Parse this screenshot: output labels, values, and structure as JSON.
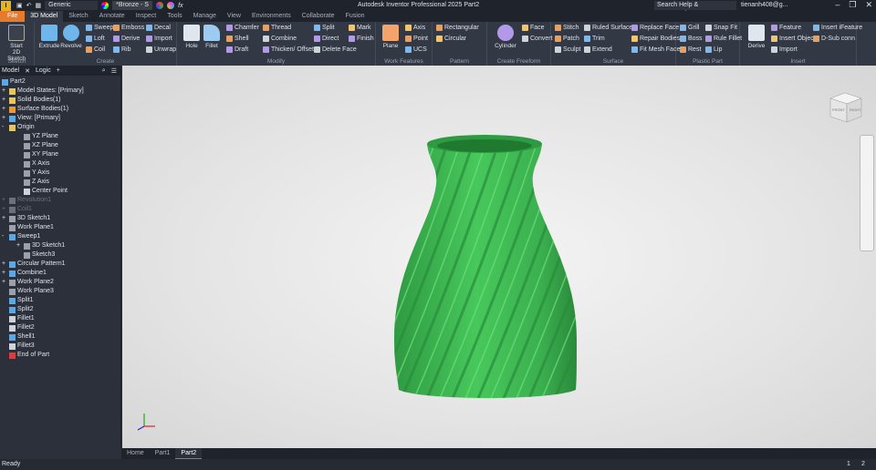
{
  "app": {
    "title": "Autodesk Inventor Professional 2025   Part2",
    "logo": "I",
    "search_placeholder": "Search Help & Commands...",
    "user": "tienanh408@g...",
    "appearance": "Generic",
    "material": "*Bronze - S"
  },
  "tabs": [
    "File",
    "3D Model",
    "Sketch",
    "Annotate",
    "Inspect",
    "Tools",
    "Manage",
    "View",
    "Environments",
    "Collaborate",
    "Fusion"
  ],
  "ribbon": {
    "sketch": {
      "label": "Sketch",
      "start": "Start",
      "start2": "2D Sketch"
    },
    "create": {
      "label": "Create",
      "extrude": "Extrude",
      "revolve": "Revolve",
      "col1": [
        "Sweep",
        "Loft",
        "Coil"
      ],
      "col2": [
        "Emboss",
        "Derive",
        "Rib"
      ],
      "col3": [
        "Decal",
        "Import",
        "Unwrap"
      ]
    },
    "modify": {
      "label": "Modify",
      "hole": "Hole",
      "fillet": "Fillet",
      "col1": [
        "Chamfer",
        "Shell",
        "Draft"
      ],
      "col2": [
        "Thread",
        "Combine",
        "Thicken/ Offset"
      ],
      "col3": [
        "Split",
        "Direct",
        "Delete Face"
      ],
      "col4": [
        "Mark",
        "Finish"
      ]
    },
    "work": {
      "label": "Work Features",
      "plane": "Plane",
      "col1": [
        "Axis",
        "Point",
        "UCS"
      ]
    },
    "pattern": {
      "label": "Pattern",
      "col1": [
        "Rectangular",
        "Circular"
      ]
    },
    "freeform": {
      "label": "Create Freeform",
      "cylinder": "Cylinder",
      "col1": [
        "Face",
        "Convert"
      ]
    },
    "surface": {
      "label": "Surface",
      "col1": [
        "Stitch",
        "Patch",
        "Sculpt"
      ],
      "col2": [
        "Ruled Surface",
        "Trim",
        "Extend"
      ],
      "col3": [
        "Replace Face",
        "Repair Bodies",
        "Fit Mesh Face"
      ]
    },
    "plastic": {
      "label": "Plastic Part",
      "col1": [
        "Grill",
        "Boss",
        "Rest"
      ],
      "col2": [
        "Snap Fit",
        "Rule Fillet",
        "Lip"
      ]
    },
    "insert": {
      "label": "Insert",
      "derive": "Derive",
      "col1": [
        "Feature",
        "Insert Object",
        "Import"
      ],
      "col2": [
        "Insert iFeature",
        "D-Sub conn"
      ]
    }
  },
  "browser": {
    "tabs": [
      "Model",
      "Logic"
    ],
    "tree": [
      {
        "label": "Part2",
        "level": 0,
        "exp": "",
        "icon": "#5aa9e6"
      },
      {
        "label": "Model States: [Primary]",
        "level": 1,
        "exp": "+",
        "icon": "#e8c65a"
      },
      {
        "label": "Solid Bodies(1)",
        "level": 1,
        "exp": "+",
        "icon": "#e8c65a"
      },
      {
        "label": "Surface Bodies(1)",
        "level": 1,
        "exp": "+",
        "icon": "#e89a3a"
      },
      {
        "label": "View: [Primary]",
        "level": 1,
        "exp": "+",
        "icon": "#5aa9e6"
      },
      {
        "label": "Origin",
        "level": 1,
        "exp": "-",
        "icon": "#e8c65a"
      },
      {
        "label": "YZ Plane",
        "level": 2,
        "exp": "",
        "icon": "#9aa1ad"
      },
      {
        "label": "XZ Plane",
        "level": 2,
        "exp": "",
        "icon": "#9aa1ad"
      },
      {
        "label": "XY Plane",
        "level": 2,
        "exp": "",
        "icon": "#9aa1ad"
      },
      {
        "label": "X Axis",
        "level": 2,
        "exp": "",
        "icon": "#9aa1ad"
      },
      {
        "label": "Y Axis",
        "level": 2,
        "exp": "",
        "icon": "#9aa1ad"
      },
      {
        "label": "Z Axis",
        "level": 2,
        "exp": "",
        "icon": "#9aa1ad"
      },
      {
        "label": "Center Point",
        "level": 2,
        "exp": "",
        "icon": "#cfd3da"
      },
      {
        "label": "Revolution1",
        "level": 1,
        "exp": "+",
        "icon": "#6b717b",
        "dim": true
      },
      {
        "label": "Coil1",
        "level": 1,
        "exp": "+",
        "icon": "#6b717b",
        "dim": true
      },
      {
        "label": "3D Sketch1",
        "level": 1,
        "exp": "+",
        "icon": "#9aa1ad"
      },
      {
        "label": "Work Plane1",
        "level": 1,
        "exp": "",
        "icon": "#9aa1ad"
      },
      {
        "label": "Sweep1",
        "level": 1,
        "exp": "-",
        "icon": "#5aa9e6"
      },
      {
        "label": "3D Sketch1",
        "level": 2,
        "exp": "+",
        "icon": "#9aa1ad"
      },
      {
        "label": "Sketch3",
        "level": 2,
        "exp": "",
        "icon": "#9aa1ad"
      },
      {
        "label": "Circular Pattern1",
        "level": 1,
        "exp": "+",
        "icon": "#5aa9e6"
      },
      {
        "label": "Combine1",
        "level": 1,
        "exp": "+",
        "icon": "#5aa9e6"
      },
      {
        "label": "Work Plane2",
        "level": 1,
        "exp": "+",
        "icon": "#9aa1ad"
      },
      {
        "label": "Work Plane3",
        "level": 1,
        "exp": "",
        "icon": "#9aa1ad"
      },
      {
        "label": "Split1",
        "level": 1,
        "exp": "",
        "icon": "#5aa9e6"
      },
      {
        "label": "Split2",
        "level": 1,
        "exp": "",
        "icon": "#5aa9e6"
      },
      {
        "label": "Fillet1",
        "level": 1,
        "exp": "",
        "icon": "#cfd3da"
      },
      {
        "label": "Fillet2",
        "level": 1,
        "exp": "",
        "icon": "#cfd3da"
      },
      {
        "label": "Shell1",
        "level": 1,
        "exp": "",
        "icon": "#5aa9e6"
      },
      {
        "label": "Fillet3",
        "level": 1,
        "exp": "",
        "icon": "#cfd3da"
      },
      {
        "label": "End of Part",
        "level": 1,
        "exp": "",
        "icon": "#e03a3a"
      }
    ]
  },
  "doc_tabs": [
    "Home",
    "Part1",
    "Part2"
  ],
  "status": {
    "text": "Ready",
    "page1": "1",
    "page2": "2"
  },
  "viewcube": {
    "front": "FRONT",
    "right": "RIGHT"
  },
  "colors": {
    "model": "#3fbf55",
    "accent": "#e87b2a"
  }
}
